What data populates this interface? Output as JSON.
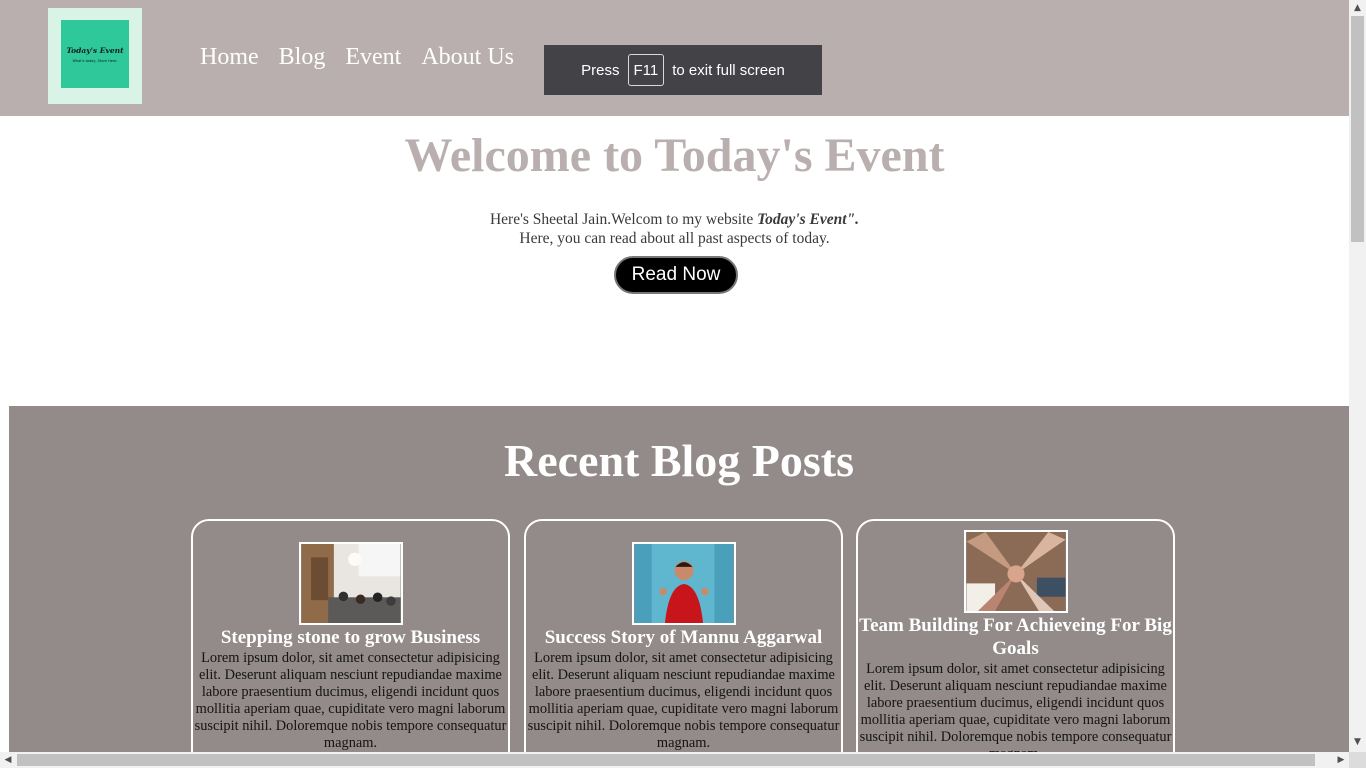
{
  "header": {
    "logo": {
      "title": "Today's Event",
      "tagline": "What's today, Store Here."
    },
    "nav": [
      "Home",
      "Blog",
      "Event",
      "About Us"
    ]
  },
  "fullscreen_toast": {
    "prefix": "Press",
    "key": "F11",
    "suffix": "to exit full screen"
  },
  "hero": {
    "title": "Welcome to Today's Event",
    "intro": "Here's Sheetal Jain.Welcom to my website",
    "site_name": "Today's Event\".",
    "line2": "Here, you can read about all past aspects of today.",
    "button": "Read Now"
  },
  "blog": {
    "title": "Recent Blog Posts",
    "posts": [
      {
        "title": "Stepping stone to grow Business",
        "text": "Lorem ipsum dolor, sit amet consectetur adipisicing elit. Deserunt aliquam nesciunt repudiandae maxime labore praesentium ducimus, eligendi incidunt quos mollitia aperiam quae, cupiditate vero magni laborum suscipit nihil. Doloremque nobis tempore consequatur magnam."
      },
      {
        "title": "Success Story of Mannu Aggarwal",
        "text": "Lorem ipsum dolor, sit amet consectetur adipisicing elit. Deserunt aliquam nesciunt repudiandae maxime labore praesentium ducimus, eligendi incidunt quos mollitia aperiam quae, cupiditate vero magni laborum suscipit nihil. Doloremque nobis tempore consequatur magnam."
      },
      {
        "title": "Team Building For Achieveing For Big Goals",
        "text": "Lorem ipsum dolor, sit amet consectetur adipisicing elit. Deserunt aliquam nesciunt repudiandae maxime labore praesentium ducimus, eligendi incidunt quos mollitia aperiam quae, cupiditate vero magni laborum suscipit nihil. Doloremque nobis tempore consequatur magnam."
      }
    ]
  },
  "colors": {
    "header_bg": "#b9afae",
    "blog_bg": "#938a8a",
    "toast_bg": "#434347",
    "logo_green": "#2fc89a"
  }
}
